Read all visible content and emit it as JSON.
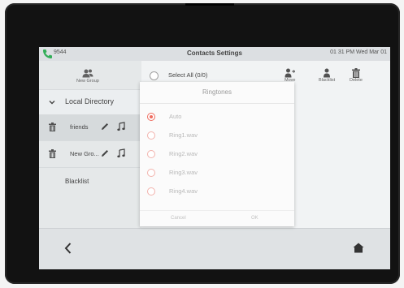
{
  "status_bar": {
    "extension": "9544",
    "title": "Contacts Settings",
    "datetime": "01 31 PM Wed Mar 01",
    "phone_icon_color": "#22a84a"
  },
  "left_panel": {
    "new_group_label": "New Group",
    "directory_label": "Local Directory",
    "groups": [
      {
        "name": "friends"
      },
      {
        "name": "New Gro..."
      }
    ],
    "blacklist_label": "Blacklist"
  },
  "right_panel": {
    "select_all_label": "Select All (0/0)",
    "tools": {
      "move_label": "Move",
      "blacklist_label": "Blacklist",
      "delete_label": "Delete"
    }
  },
  "dialog": {
    "title": "Ringtones",
    "options": [
      "Auto",
      "Ring1.wav",
      "Ring2.wav",
      "Ring3.wav",
      "Ring4.wav"
    ],
    "selected": "Auto",
    "cancel_label": "Cancel",
    "ok_label": "OK",
    "accent_color": "#ef6b5e"
  }
}
